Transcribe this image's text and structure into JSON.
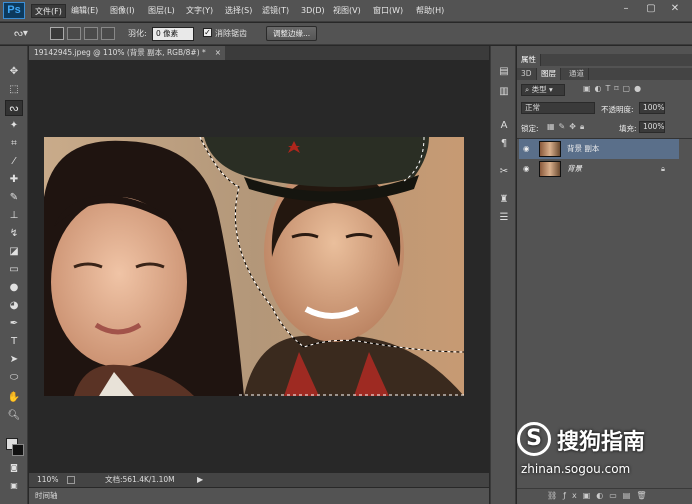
{
  "app": {
    "logo": "Ps"
  },
  "menu": [
    "文件(F)",
    "编辑(E)",
    "图像(I)",
    "图层(L)",
    "文字(Y)",
    "选择(S)",
    "滤镜(T)",
    "3D(D)",
    "视图(V)",
    "窗口(W)",
    "帮助(H)"
  ],
  "window_controls": {
    "minimize": "–",
    "restore": "▢",
    "close": "✕"
  },
  "options": {
    "feather_label": "羽化:",
    "feather_value": "0 像素",
    "antialias_label": "消除锯齿",
    "refine_edge": "调整边缘..."
  },
  "document": {
    "tab_title": "19142945.jpeg @ 110% (背景 副本, RGB/8#) *",
    "tab_close": "×",
    "zoom": "110%",
    "doc_info": "文档:561.4K/1.10M",
    "timeline": "时间轴"
  },
  "panels": {
    "properties_tab": "属性",
    "tabs": [
      "3D",
      "图层",
      "通道"
    ],
    "filter_kind": "类型",
    "blend_mode": "正常",
    "opacity_label": "不透明度:",
    "opacity_value": "100%",
    "lock_label": "锁定:",
    "fill_label": "填充:",
    "fill_value": "100%",
    "layers": [
      {
        "name": "背景 副本",
        "selected": true
      },
      {
        "name": "背景",
        "selected": false
      }
    ]
  },
  "watermark": {
    "brand": "搜狗指南",
    "url": "zhinan.sogou.com"
  }
}
